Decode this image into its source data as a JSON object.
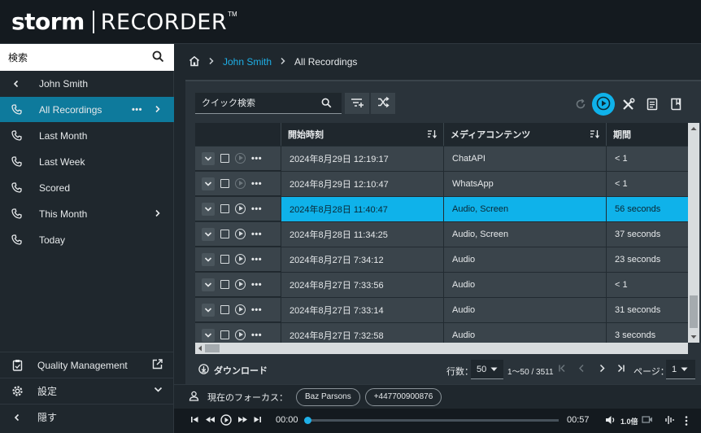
{
  "app": {
    "brand": "storm",
    "product": "RECORDER",
    "trademark": "TM"
  },
  "sidebar": {
    "search_placeholder": "検索",
    "back_label": "John Smith",
    "items": [
      {
        "label": "All Recordings",
        "active": true,
        "more": "•••"
      },
      {
        "label": "Last Month"
      },
      {
        "label": "Last Week"
      },
      {
        "label": "Scored"
      },
      {
        "label": "This Month"
      },
      {
        "label": "Today"
      }
    ],
    "bottom": [
      {
        "label": "Quality Management"
      },
      {
        "label": "設定"
      },
      {
        "label": "隠す"
      }
    ]
  },
  "breadcrumb": {
    "parent": "John Smith",
    "current": "All Recordings"
  },
  "toolbar": {
    "quick_search_placeholder": "クイック検索"
  },
  "table": {
    "columns": [
      "開始時刻",
      "メディアコンテンツ",
      "期間"
    ],
    "rows": [
      {
        "start": "2024年8月29日 12:19:17",
        "media": "ChatAPI",
        "duration": "< 1",
        "selected": false
      },
      {
        "start": "2024年8月29日 12:10:47",
        "media": "WhatsApp",
        "duration": "< 1",
        "selected": false
      },
      {
        "start": "2024年8月28日 11:40:47",
        "media": "Audio, Screen",
        "duration": "56 seconds",
        "selected": true
      },
      {
        "start": "2024年8月28日 11:34:25",
        "media": "Audio, Screen",
        "duration": "37 seconds",
        "selected": false
      },
      {
        "start": "2024年8月27日 7:34:12",
        "media": "Audio",
        "duration": "23 seconds",
        "selected": false
      },
      {
        "start": "2024年8月27日 7:33:56",
        "media": "Audio",
        "duration": "< 1",
        "selected": false
      },
      {
        "start": "2024年8月27日 7:33:14",
        "media": "Audio",
        "duration": "31 seconds",
        "selected": false
      },
      {
        "start": "2024年8月27日 7:32:58",
        "media": "Audio",
        "duration": "3 seconds",
        "selected": false
      }
    ]
  },
  "footer": {
    "download_label": "ダウンロード",
    "rows_label": "行数：",
    "rows_value": "50",
    "range": "1〜50 / 3511",
    "page_label": "ページ：",
    "page_value": "1"
  },
  "focus": {
    "label": "現在のフォーカス：",
    "chips": [
      "Baz Parsons",
      "+447700900876"
    ]
  },
  "player": {
    "current": "00:00",
    "total": "00:57",
    "speed": "1.0倍",
    "progress": 0
  },
  "colors": {
    "accent": "#0fb2ea",
    "active_nav": "#0e7a9c",
    "link": "#1fb0e8"
  }
}
